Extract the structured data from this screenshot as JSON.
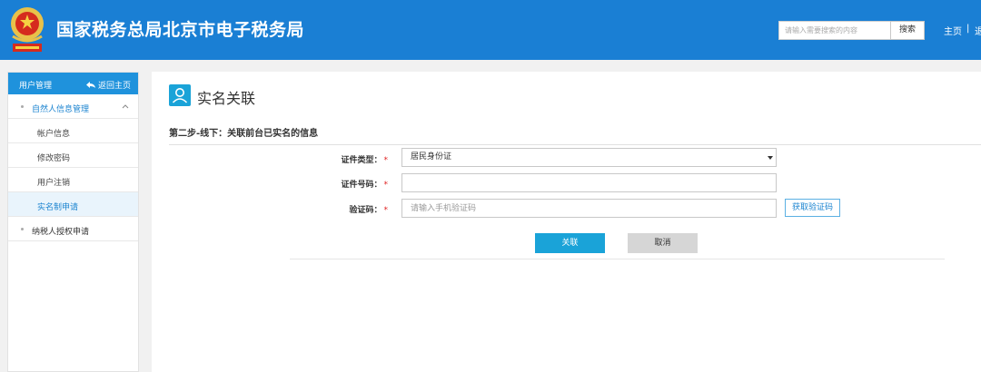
{
  "header": {
    "title": "国家税务总局北京市电子税务局",
    "search_placeholder": "请输入需要搜索的内容",
    "search_button": "搜索",
    "nav_home": "主页",
    "nav_separator": "|",
    "nav_more": "退",
    "bg_color": "#1a7fd4"
  },
  "sidebar": {
    "title": "用户管理",
    "back_home": "返回主页",
    "items": [
      {
        "label": "自然人信息管理"
      },
      {
        "label": "帐户信息"
      },
      {
        "label": "修改密码"
      },
      {
        "label": "用户注销"
      },
      {
        "label": "实名制申请"
      },
      {
        "label": "纳税人授权申请"
      }
    ],
    "accent_color": "#1f92dc"
  },
  "main": {
    "page_title": "实名关联",
    "step_title": "第二步-线下：关联前台已实名的信息",
    "form": {
      "id_type": {
        "label": "证件类型：",
        "required_mark": "*",
        "value": "居民身份证"
      },
      "id_number": {
        "label": "证件号码：",
        "required_mark": "*",
        "value": ""
      },
      "verify_code": {
        "label": "验证码：",
        "required_mark": "*",
        "placeholder": "请输入手机验证码",
        "get_code_label": "获取验证码"
      }
    },
    "submit_label": "关联",
    "cancel_label": "取消"
  }
}
